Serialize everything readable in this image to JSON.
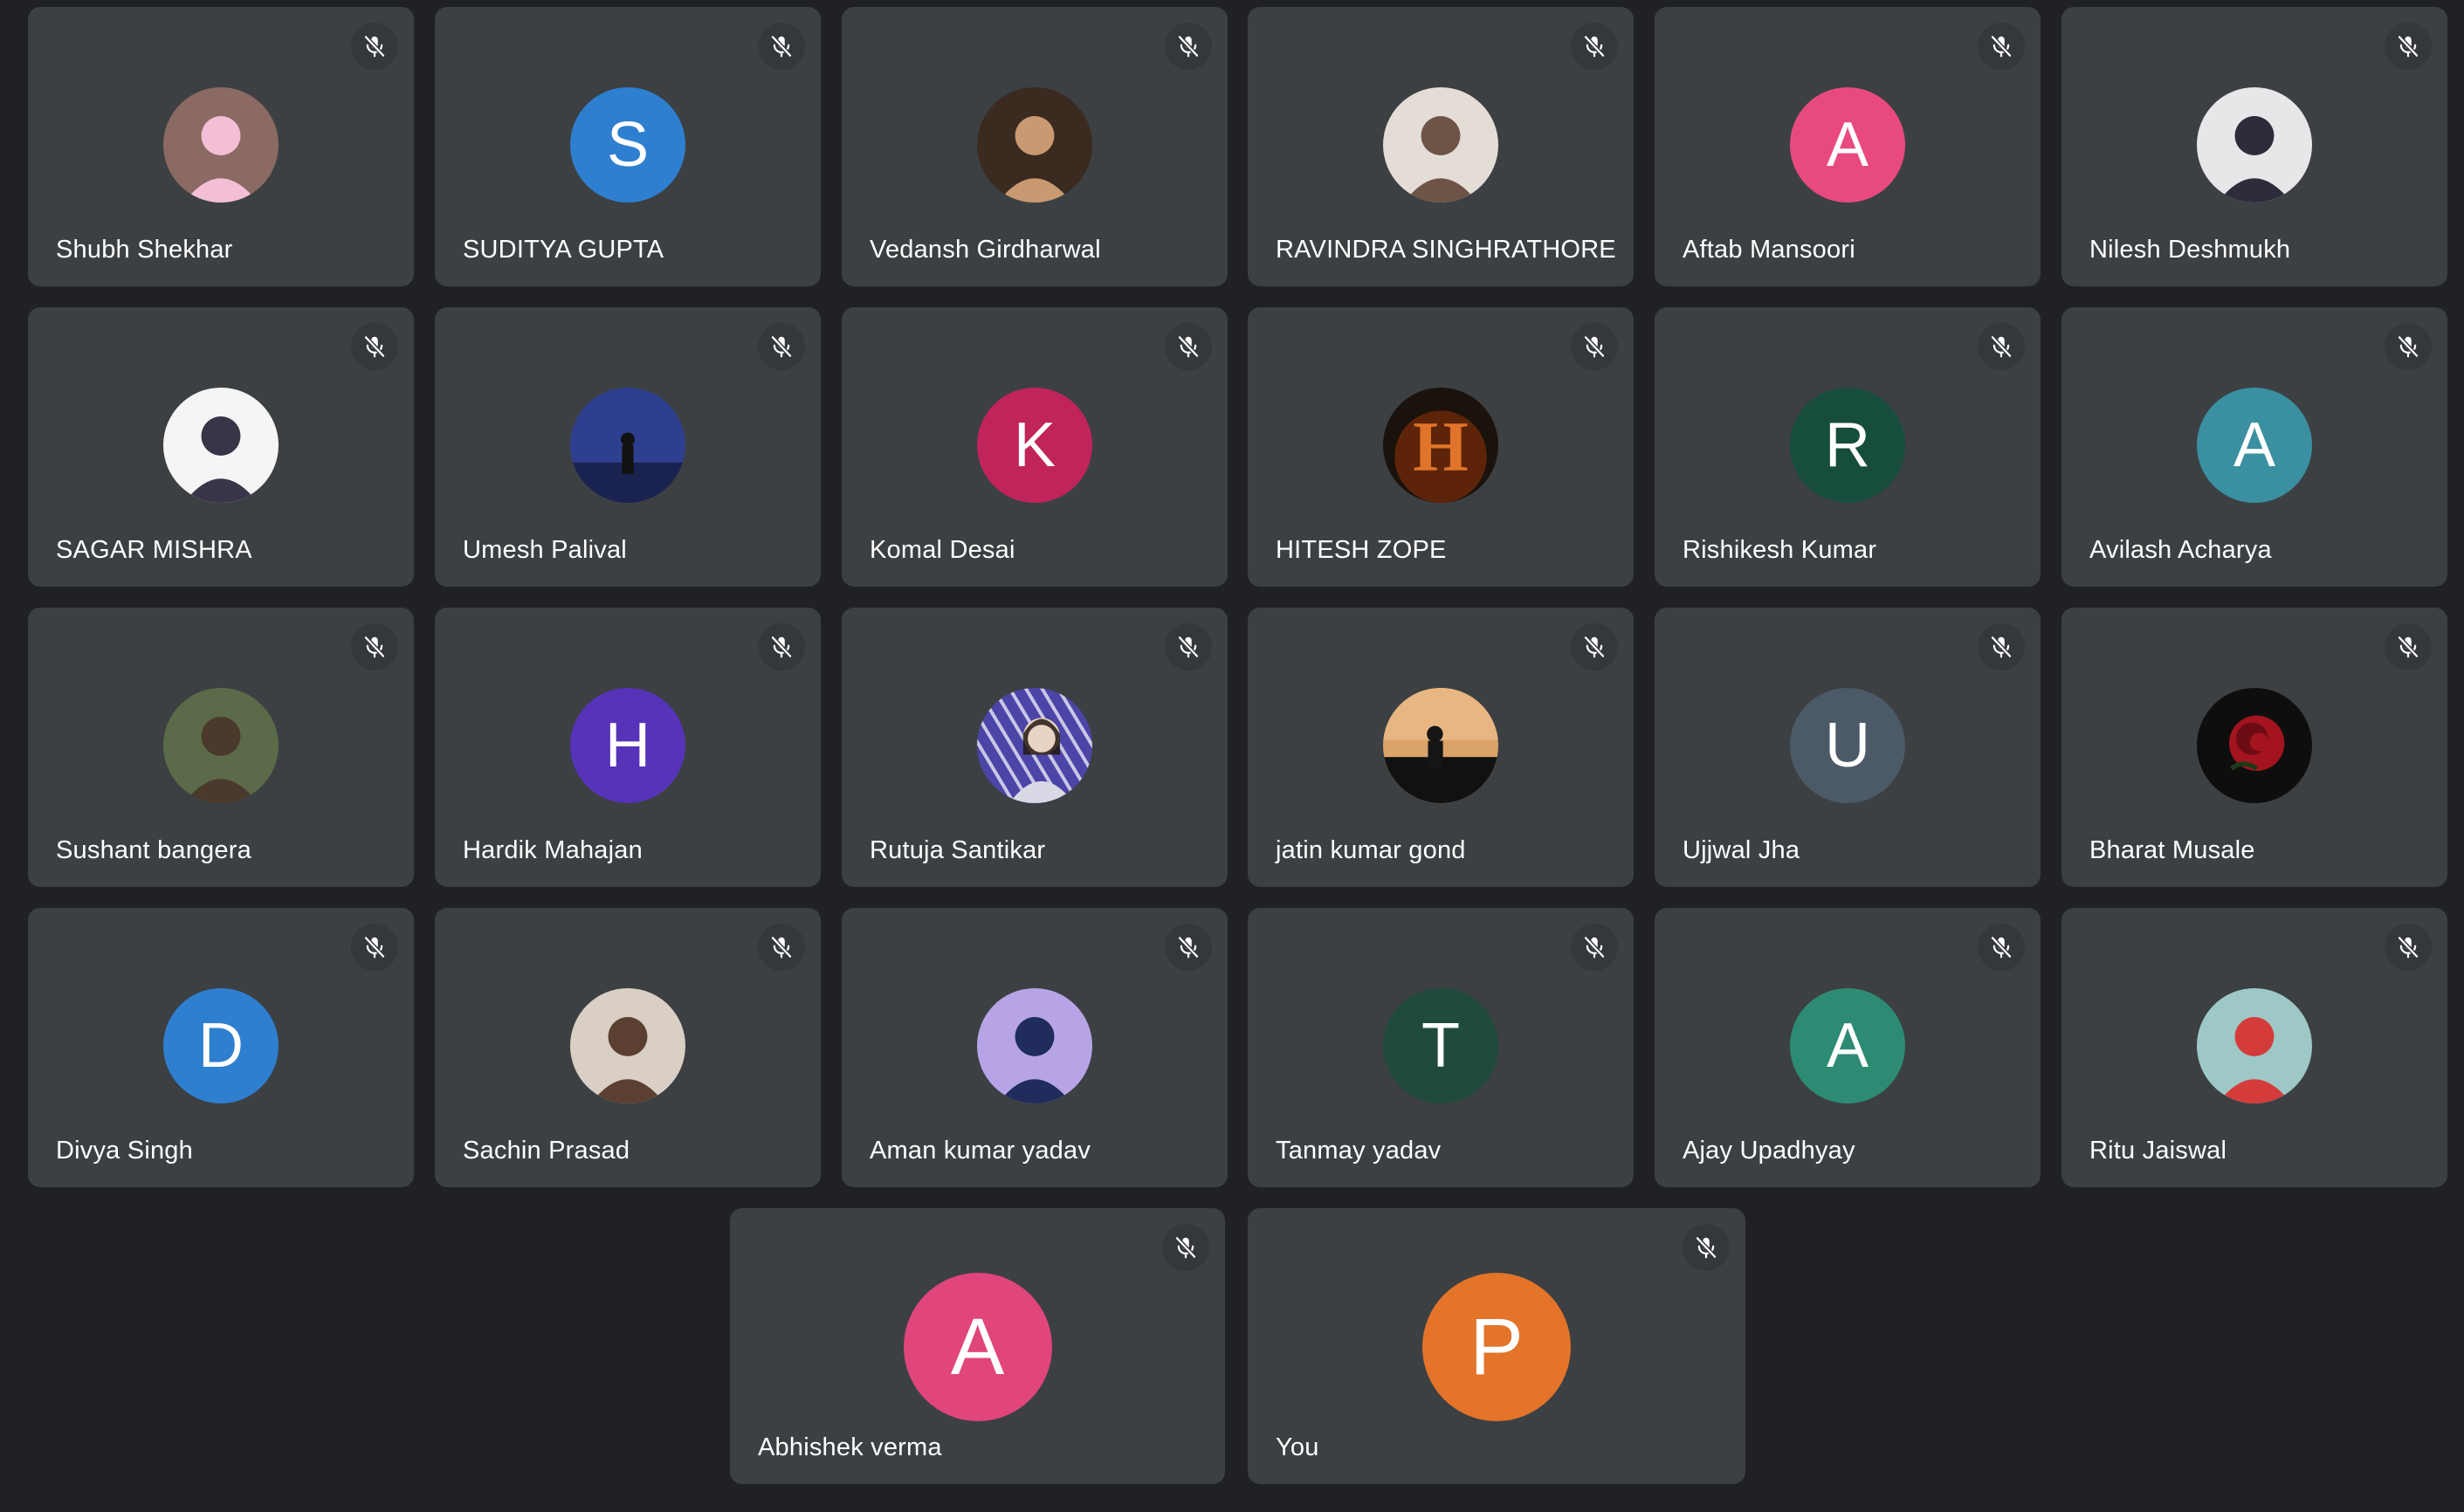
{
  "colors": {
    "background": "#202124",
    "tile": "#3c4043",
    "mute_badge": "#34373b",
    "text": "#ffffff"
  },
  "participants": [
    {
      "name": "Shubh Shekhar",
      "avatar": {
        "type": "photo",
        "photo": "person-pink-shirt-seated",
        "bg": "#8a6a62",
        "fg": "#f2bfd6"
      }
    },
    {
      "name": "SUDITYA GUPTA",
      "avatar": {
        "type": "initial",
        "letter": "S",
        "color": "#2f7fd0"
      }
    },
    {
      "name": "Vedansh Girdharwal",
      "avatar": {
        "type": "photo",
        "photo": "person-dark-night",
        "bg": "#3a2a20",
        "fg": "#c99a72"
      }
    },
    {
      "name": "RAVINDRA SINGHRATHORE",
      "avatar": {
        "type": "photo",
        "photo": "person-light-bg",
        "bg": "#e4ddd6",
        "fg": "#6e5446"
      }
    },
    {
      "name": "Aftab Mansoori",
      "avatar": {
        "type": "initial",
        "letter": "A",
        "color": "#e84a7f"
      }
    },
    {
      "name": "Nilesh Deshmukh",
      "avatar": {
        "type": "photo",
        "photo": "person-white-bg",
        "bg": "#e7e7ea",
        "fg": "#2c2c3a"
      }
    },
    {
      "name": "SAGAR MISHRA",
      "avatar": {
        "type": "photo",
        "photo": "person-white-shirt",
        "bg": "#f5f5f5",
        "fg": "#3a3448"
      }
    },
    {
      "name": "Umesh Palival",
      "avatar": {
        "type": "photo",
        "photo": "silhouette-blue-sky",
        "bg": "#2f3f8f",
        "fg": "#111"
      }
    },
    {
      "name": "Komal Desai",
      "avatar": {
        "type": "initial",
        "letter": "K",
        "color": "#c0245a"
      }
    },
    {
      "name": "HITESH ZOPE",
      "avatar": {
        "type": "photo",
        "photo": "letter-h-fire",
        "bg": "#1a120c",
        "fg": "#e0742a"
      }
    },
    {
      "name": "Rishikesh Kumar",
      "avatar": {
        "type": "initial",
        "letter": "R",
        "color": "#174d3c"
      }
    },
    {
      "name": "Avilash Acharya",
      "avatar": {
        "type": "initial",
        "letter": "A",
        "color": "#3a8fa0"
      }
    },
    {
      "name": "Sushant bangera",
      "avatar": {
        "type": "photo",
        "photo": "person-sunglasses-outdoor",
        "bg": "#5b6a48",
        "fg": "#4a3a2c"
      }
    },
    {
      "name": "Hardik Mahajan",
      "avatar": {
        "type": "initial",
        "letter": "H",
        "color": "#5633b8"
      }
    },
    {
      "name": "Rutuja Santikar",
      "avatar": {
        "type": "photo",
        "photo": "woman-striped-bg",
        "bg": "#4b45a8",
        "fg": "#e8d4c4"
      }
    },
    {
      "name": "jatin kumar gond",
      "avatar": {
        "type": "photo",
        "photo": "silhouette-sunset",
        "bg": "#d9a36a",
        "fg": "#151515"
      }
    },
    {
      "name": "Ujjwal Jha",
      "avatar": {
        "type": "initial",
        "letter": "U",
        "color": "#4b5a66"
      }
    },
    {
      "name": "Bharat Musale",
      "avatar": {
        "type": "photo",
        "photo": "red-rose-black",
        "bg": "#0e0e0e",
        "fg": "#a3141f"
      }
    },
    {
      "name": "Divya Singh",
      "avatar": {
        "type": "initial",
        "letter": "D",
        "color": "#2f7fd0"
      }
    },
    {
      "name": "Sachin Prasad",
      "avatar": {
        "type": "photo",
        "photo": "person-phone-selfie",
        "bg": "#d9cfc4",
        "fg": "#5b4032"
      }
    },
    {
      "name": "Aman kumar yadav",
      "avatar": {
        "type": "photo",
        "photo": "person-blue-vest-purple-bg",
        "bg": "#b7a4e6",
        "fg": "#1f2c5c"
      }
    },
    {
      "name": "Tanmay yadav",
      "avatar": {
        "type": "initial",
        "letter": "T",
        "color": "#1f4a3c"
      }
    },
    {
      "name": "Ajay Upadhyay",
      "avatar": {
        "type": "initial",
        "letter": "A",
        "color": "#2e8b73"
      }
    },
    {
      "name": "Ritu Jaiswal",
      "avatar": {
        "type": "photo",
        "photo": "woman-red-dress-green-bg",
        "bg": "#9ec8c6",
        "fg": "#d43c3c"
      }
    },
    {
      "name": "Abhishek verma",
      "avatar": {
        "type": "initial",
        "letter": "A",
        "color": "#e0457b"
      }
    },
    {
      "name": "You",
      "avatar": {
        "type": "initial",
        "letter": "P",
        "color": "#e37429"
      }
    }
  ],
  "icons": {
    "mute": "mic-off-icon"
  }
}
